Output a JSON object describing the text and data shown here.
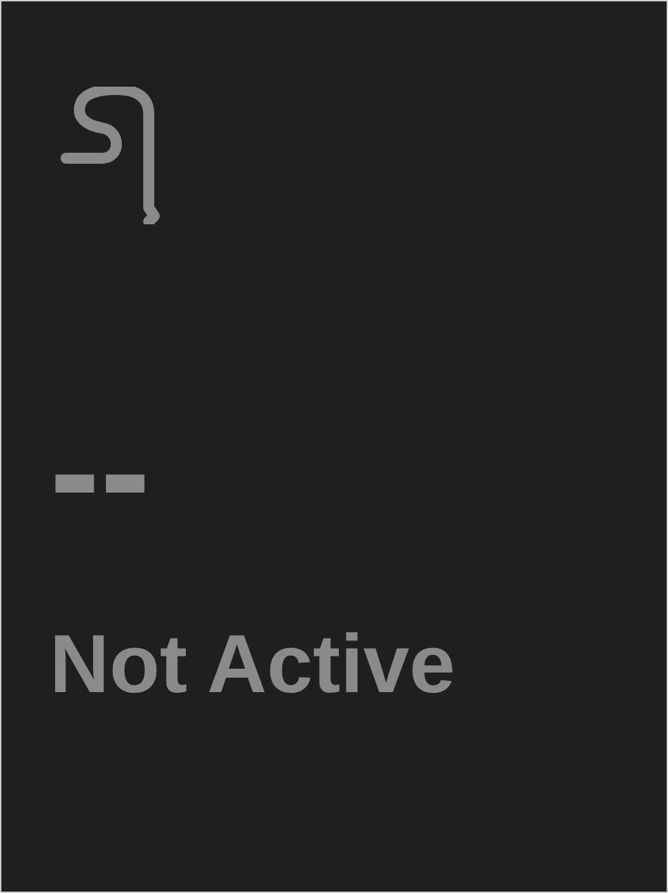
{
  "card": {
    "value": "--",
    "state": "Not Active"
  }
}
